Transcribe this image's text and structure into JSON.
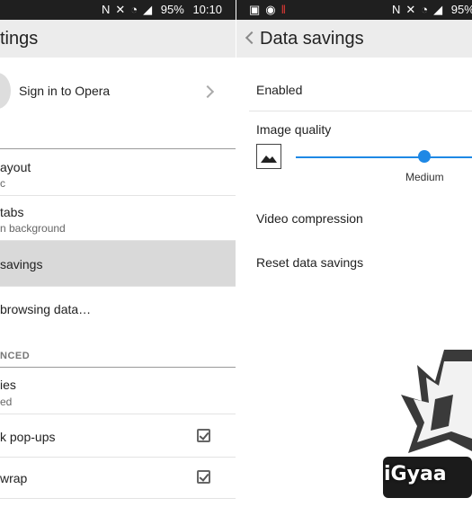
{
  "colors": {
    "accent": "#1e88e5",
    "status_bar": "#1f1f1f",
    "app_bar": "#ececec",
    "selected_row": "#d9d9d9"
  },
  "left": {
    "status": {
      "battery": "95%",
      "time": "10:10",
      "icons": [
        "nfc-icon",
        "mute-icon",
        "wifi-icon",
        "signal-icon"
      ]
    },
    "title": "tings",
    "account": {
      "label": "Sign in to Opera"
    },
    "items": [
      {
        "title": "ayout",
        "sub": "c"
      },
      {
        "title": "tabs",
        "sub": "n background"
      },
      {
        "title": "savings",
        "sub": ""
      },
      {
        "title": " browsing data…",
        "sub": ""
      }
    ],
    "advanced_header": "NCED",
    "advanced": [
      {
        "title": "ies",
        "sub": "ed"
      },
      {
        "title": "k pop-ups",
        "checked": true
      },
      {
        "title": "wrap",
        "checked": true
      }
    ]
  },
  "right": {
    "status": {
      "battery": "95%",
      "icons": [
        "gallery-icon",
        "app-icon",
        "pause-icon",
        "nfc-icon",
        "mute-icon",
        "wifi-icon",
        "signal-icon"
      ]
    },
    "title": "Data savings",
    "enabled_label": "Enabled",
    "image_quality": {
      "label": "Image quality",
      "value_label": "Medium",
      "value_fraction": 0.5
    },
    "video_label": "Video compression",
    "reset_label": "Reset data savings"
  },
  "watermark": {
    "text": "iGyaa"
  }
}
